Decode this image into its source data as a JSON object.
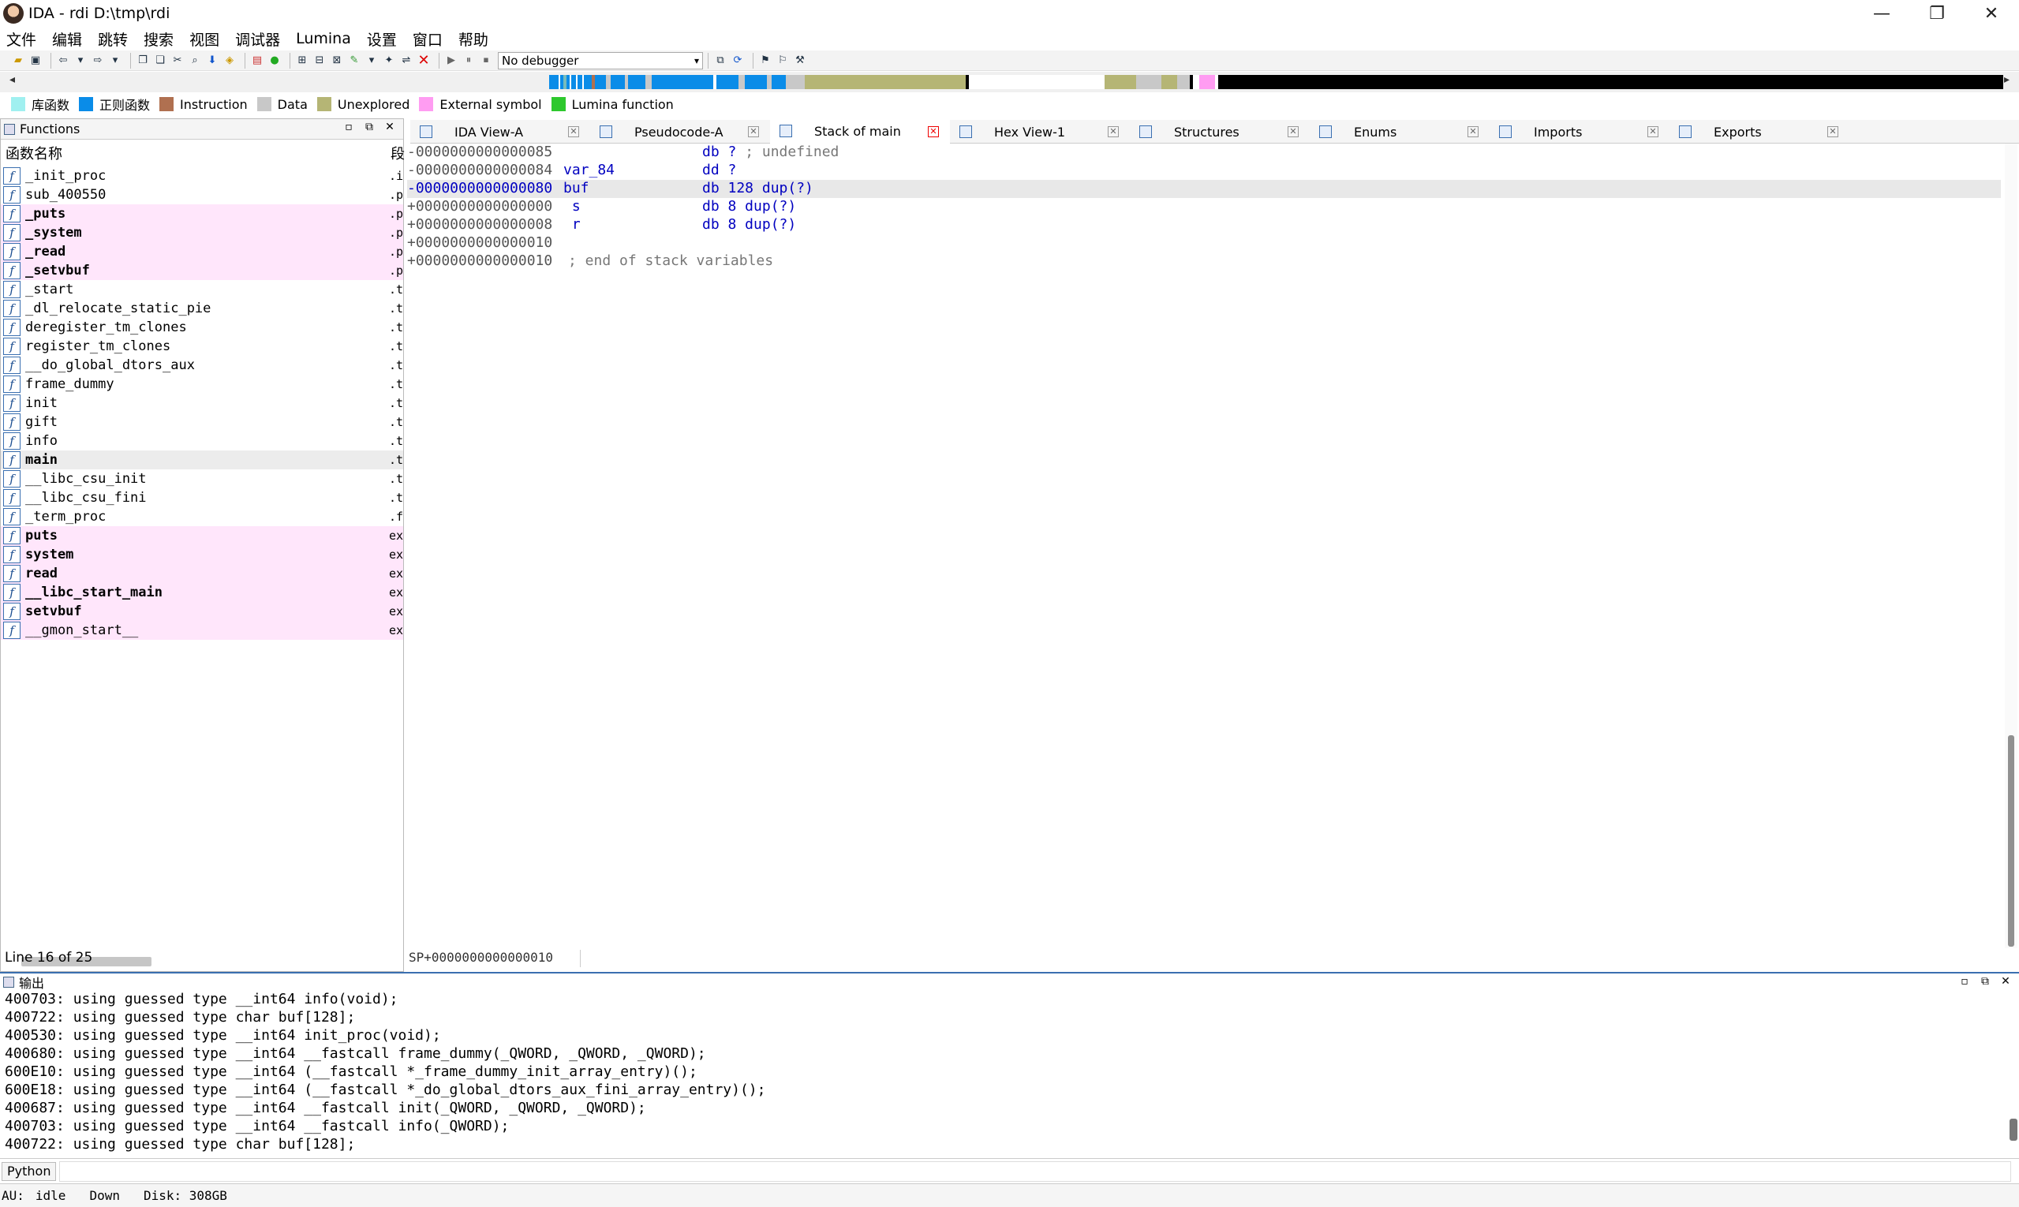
{
  "window": {
    "title": "IDA - rdi D:\\tmp\\rdi",
    "min": "—",
    "max": "❐",
    "close": "✕"
  },
  "menu": [
    "文件",
    "编辑",
    "跳转",
    "搜索",
    "视图",
    "调试器",
    "Lumina",
    "设置",
    "窗口",
    "帮助"
  ],
  "toolbar": {
    "debugger_label": "No debugger",
    "debugger_arrow": "▾"
  },
  "legend": [
    {
      "label": "库函数",
      "color": "#a0f0f0"
    },
    {
      "label": "正则函数",
      "color": "#0a8ce8"
    },
    {
      "label": "Instruction",
      "color": "#b07050"
    },
    {
      "label": "Data",
      "color": "#c8c8c8"
    },
    {
      "label": "Unexplored",
      "color": "#b5b575"
    },
    {
      "label": "External symbol",
      "color": "#ff9cf2"
    },
    {
      "label": "Lumina function",
      "color": "#2dc82d"
    }
  ],
  "functions": {
    "title": "Functions",
    "col_name": "函数名称",
    "col_seg": "段",
    "rows": [
      {
        "name": "_init_proc",
        "seg": ".i",
        "type": "normal"
      },
      {
        "name": "sub_400550",
        "seg": ".p",
        "type": "normal"
      },
      {
        "name": "_puts",
        "seg": ".p",
        "type": "lib"
      },
      {
        "name": "_system",
        "seg": ".p",
        "type": "lib"
      },
      {
        "name": "_read",
        "seg": ".p",
        "type": "lib"
      },
      {
        "name": "_setvbuf",
        "seg": ".p",
        "type": "lib"
      },
      {
        "name": "_start",
        "seg": ".t",
        "type": "normal"
      },
      {
        "name": "_dl_relocate_static_pie",
        "seg": ".t",
        "type": "normal"
      },
      {
        "name": "deregister_tm_clones",
        "seg": ".t",
        "type": "normal"
      },
      {
        "name": "register_tm_clones",
        "seg": ".t",
        "type": "normal"
      },
      {
        "name": "__do_global_dtors_aux",
        "seg": ".t",
        "type": "normal"
      },
      {
        "name": "frame_dummy",
        "seg": ".t",
        "type": "normal"
      },
      {
        "name": "init",
        "seg": ".t",
        "type": "normal"
      },
      {
        "name": "gift",
        "seg": ".t",
        "type": "normal"
      },
      {
        "name": "info",
        "seg": ".t",
        "type": "normal"
      },
      {
        "name": "main",
        "seg": ".t",
        "type": "selected"
      },
      {
        "name": "__libc_csu_init",
        "seg": ".t",
        "type": "normal"
      },
      {
        "name": "__libc_csu_fini",
        "seg": ".t",
        "type": "normal"
      },
      {
        "name": "_term_proc",
        "seg": ".f",
        "type": "normal"
      },
      {
        "name": "puts",
        "seg": "ex",
        "type": "lib"
      },
      {
        "name": "system",
        "seg": "ex",
        "type": "lib"
      },
      {
        "name": "read",
        "seg": "ex",
        "type": "lib"
      },
      {
        "name": "__libc_start_main",
        "seg": "ex",
        "type": "lib"
      },
      {
        "name": "setvbuf",
        "seg": "ex",
        "type": "lib"
      },
      {
        "name": "__gmon_start__",
        "seg": "ex",
        "type": "libplain"
      }
    ],
    "status": "Line 16 of 25"
  },
  "tabs": [
    {
      "label": "IDA View-A",
      "active": false
    },
    {
      "label": "Pseudocode-A",
      "active": false
    },
    {
      "label": "Stack of main",
      "active": true
    },
    {
      "label": "Hex View-1",
      "active": false
    },
    {
      "label": "Structures",
      "active": false
    },
    {
      "label": "Enums",
      "active": false
    },
    {
      "label": "Imports",
      "active": false
    },
    {
      "label": "Exports",
      "active": false
    }
  ],
  "stack": {
    "lines": [
      {
        "off": "-0000000000000085",
        "name": "",
        "op": "db ? ; undefined",
        "cur": false
      },
      {
        "off": "-0000000000000084",
        "name": "var_84",
        "op": "dd ?",
        "cur": false
      },
      {
        "off": "-0000000000000080",
        "name": "buf",
        "op": "db 128 dup(?)",
        "cur": true
      },
      {
        "off": "+0000000000000000",
        "name": " s",
        "op": "db 8 dup(?)",
        "cur": false
      },
      {
        "off": "+0000000000000008",
        "name": " r",
        "op": "db 8 dup(?)",
        "cur": false
      },
      {
        "off": "+0000000000000010",
        "name": "",
        "op": "",
        "cur": false
      },
      {
        "off": "+0000000000000010",
        "name": "; end of stack variables",
        "op": "",
        "cur": false
      }
    ],
    "sp_status": "SP+0000000000000010"
  },
  "output": {
    "title": "输出",
    "lines": [
      "400703: using guessed type __int64 info(void);",
      "400722: using guessed type char buf[128];",
      "400530: using guessed type __int64 init_proc(void);",
      "400680: using guessed type __int64 __fastcall frame_dummy(_QWORD, _QWORD, _QWORD);",
      "600E10: using guessed type __int64 (__fastcall *_frame_dummy_init_array_entry)();",
      "600E18: using guessed type __int64 (__fastcall *_do_global_dtors_aux_fini_array_entry)();",
      "400687: using guessed type __int64 __fastcall init(_QWORD, _QWORD, _QWORD);",
      "400703: using guessed type __int64 __fastcall info(_QWORD);",
      "400722: using guessed type char buf[128];"
    ]
  },
  "python": {
    "label": "Python"
  },
  "status": {
    "au": "AU:",
    "state": "idle",
    "dir": "Down",
    "disk": "Disk: 308GB"
  }
}
